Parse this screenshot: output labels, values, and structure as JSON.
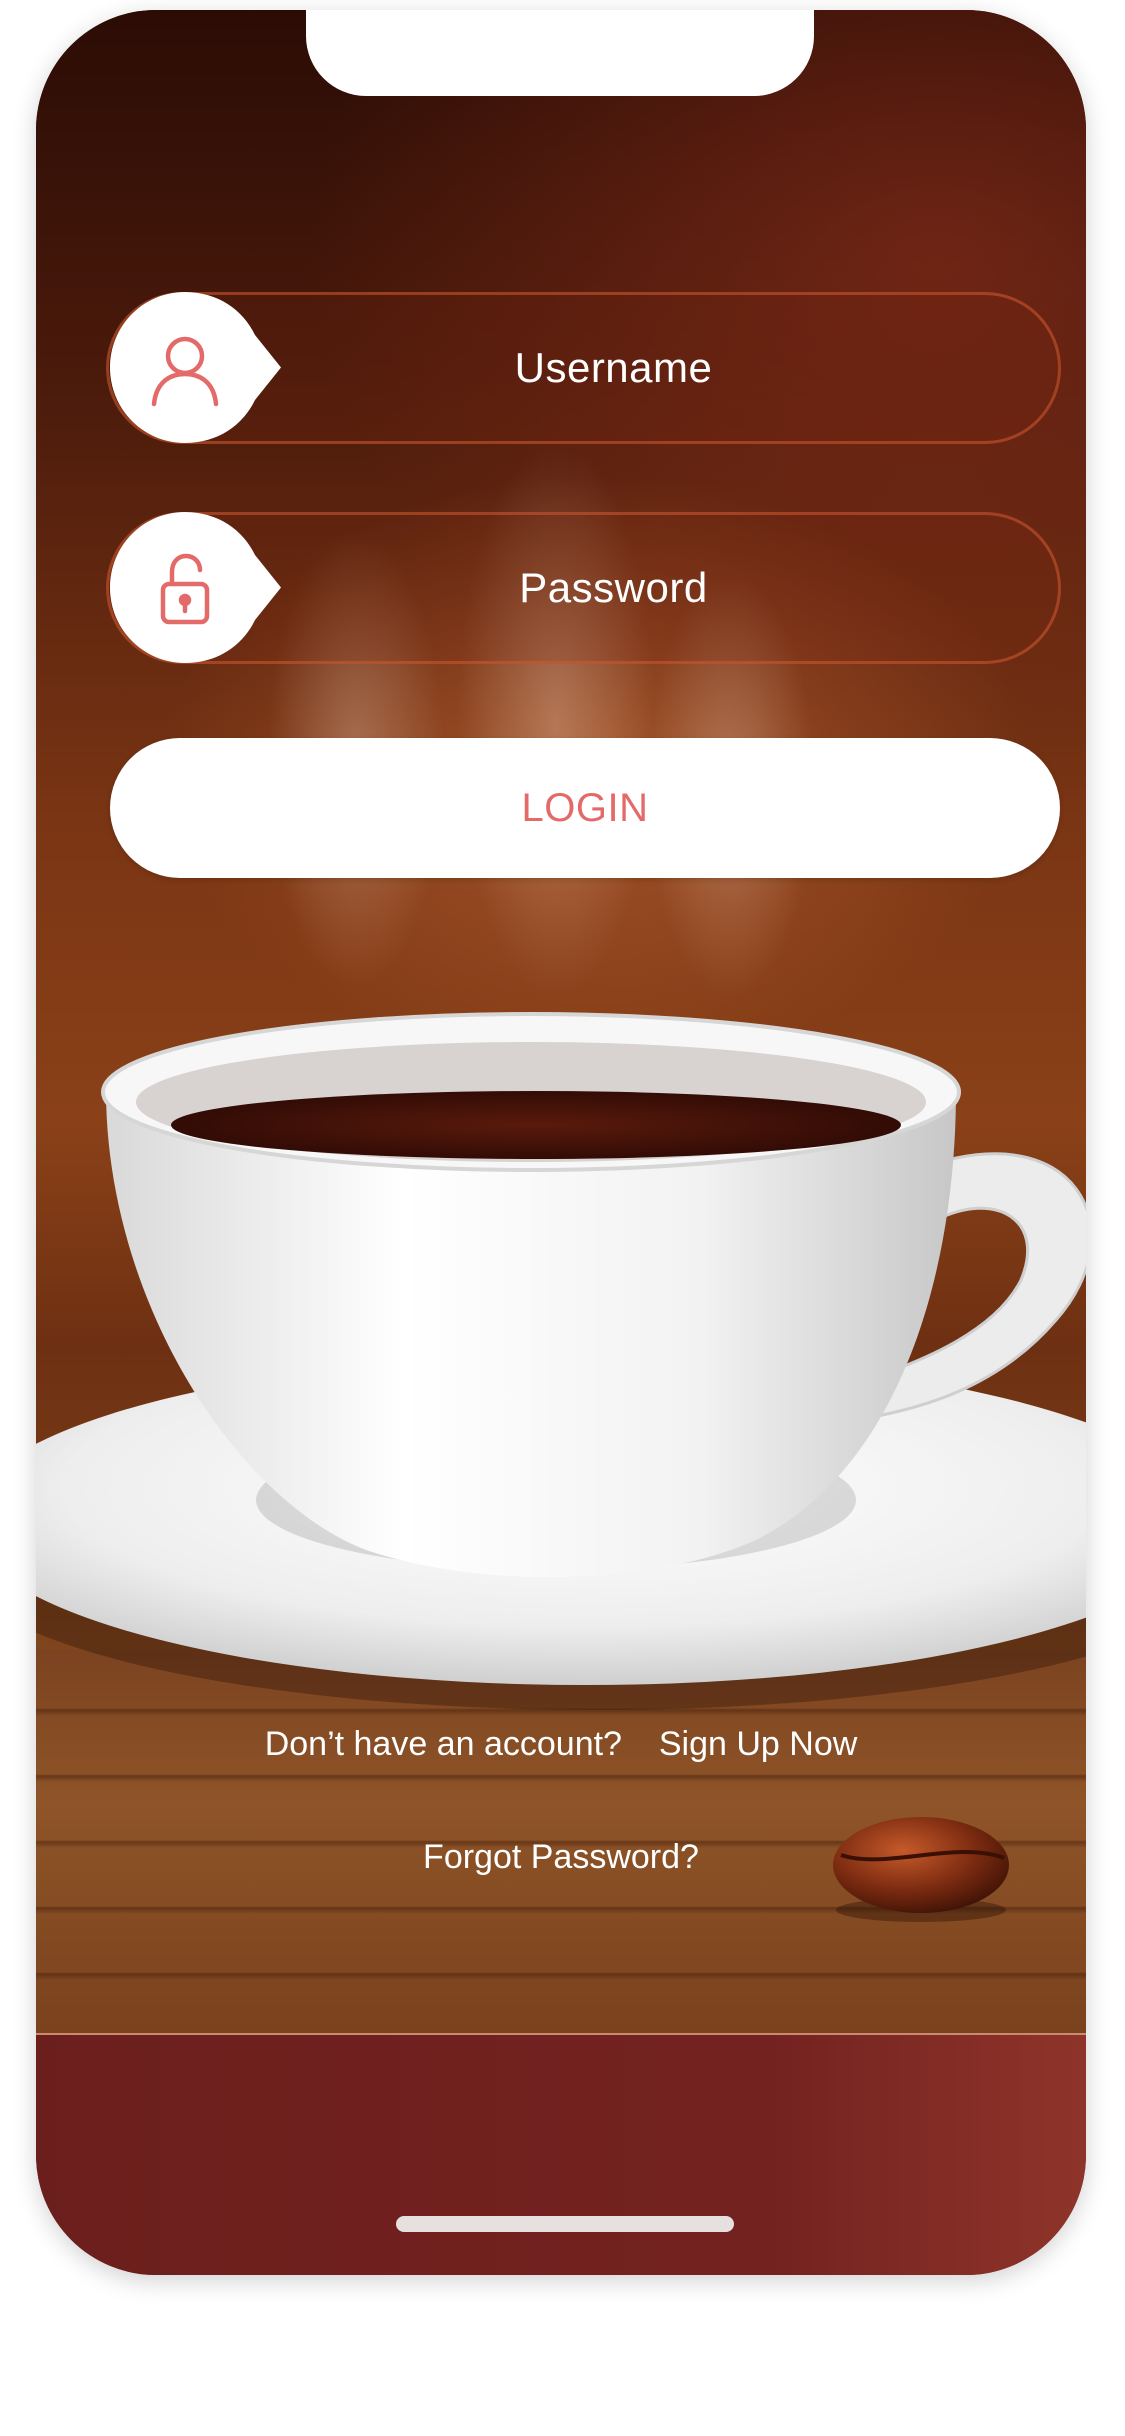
{
  "login_form": {
    "username_placeholder": "Username",
    "password_placeholder": "Password",
    "login_label": "LOGIN"
  },
  "footer_links": {
    "no_account_text": "Don’t have an account?",
    "signup_label": "Sign Up Now",
    "forgot_password_label": "Forgot Password?"
  },
  "icons": {
    "username": "user-icon",
    "password": "unlock-icon"
  },
  "colors": {
    "accent": "#e46a6a",
    "brown_dark": "#4a1a0b",
    "bottom_band": "#742220"
  }
}
